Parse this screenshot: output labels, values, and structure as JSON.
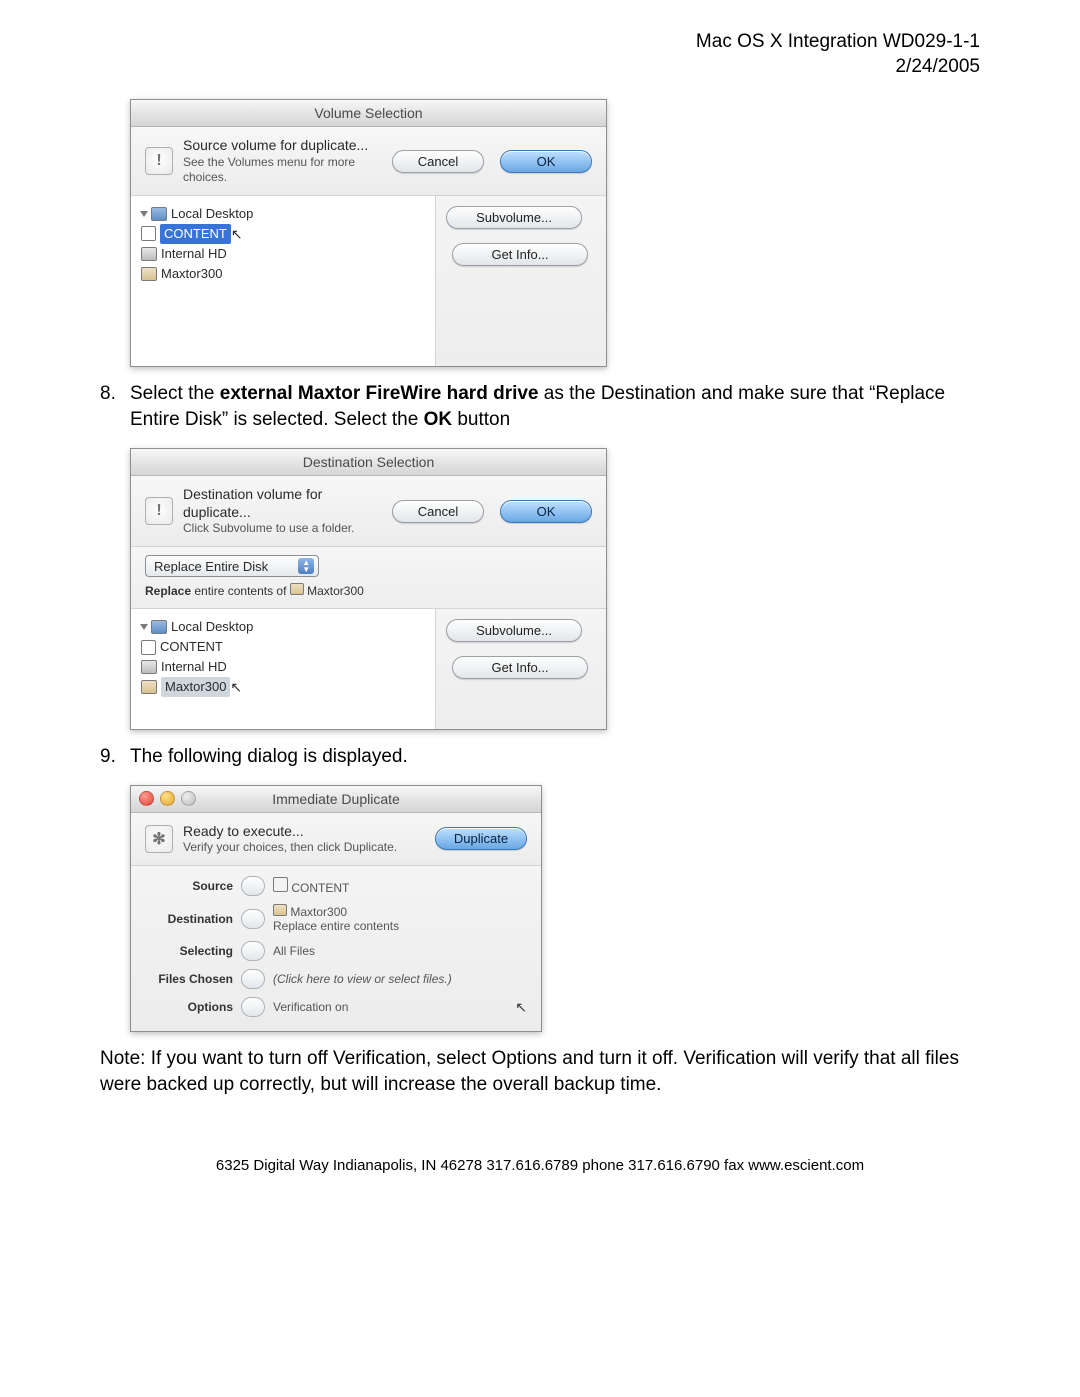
{
  "header": {
    "title": "Mac OS X Integration WD029-1-1",
    "date": "2/24/2005"
  },
  "step8": {
    "num": "8.",
    "pre": "Select the ",
    "bold1": "external Maxtor FireWire hard drive",
    "mid": " as the Destination and make sure that “Replace Entire Disk” is selected. Select the ",
    "bold2": "OK",
    "post": " button"
  },
  "step9": {
    "num": "9.",
    "text": "The following dialog is displayed."
  },
  "note": "Note: If you want to turn off Verification, select Options and turn it off. Verification will verify that all files were backed up correctly, but will increase the overall backup time.",
  "footer": "6325 Digital Way   Indianapolis, IN 46278   317.616.6789 phone   317.616.6790 fax   www.escient.com",
  "common": {
    "cancel": "Cancel",
    "ok": "OK",
    "subvolume": "Subvolume...",
    "getinfo": "Get Info...",
    "tree_root": "Local Desktop",
    "tree_content": "CONTENT",
    "tree_internal": "Internal HD",
    "tree_maxtor": "Maxtor300"
  },
  "dlg1": {
    "title": "Volume Selection",
    "msg1": "Source volume for duplicate...",
    "msg2": "See the Volumes menu for more choices."
  },
  "dlg2": {
    "title": "Destination Selection",
    "msg1": "Destination volume for duplicate...",
    "msg2": "Click Subvolume to use a folder.",
    "popup": "Replace Entire Disk",
    "replace_a": "Replace",
    "replace_b": " entire contents of ",
    "replace_c": "Maxtor300"
  },
  "dlg3": {
    "title": "Immediate Duplicate",
    "msg1": "Ready to execute...",
    "msg2": "Verify your choices, then click Duplicate.",
    "dup": "Duplicate",
    "rows": {
      "source_lbl": "Source",
      "source_val": "CONTENT",
      "dest_lbl": "Destination",
      "dest_val": "Maxtor300",
      "dest_red": "Replace entire contents",
      "sel_lbl": "Selecting",
      "sel_val": "All Files",
      "files_lbl": "Files Chosen",
      "files_val": "(Click here to view or select files.)",
      "opt_lbl": "Options",
      "opt_val": "Verification on"
    }
  }
}
